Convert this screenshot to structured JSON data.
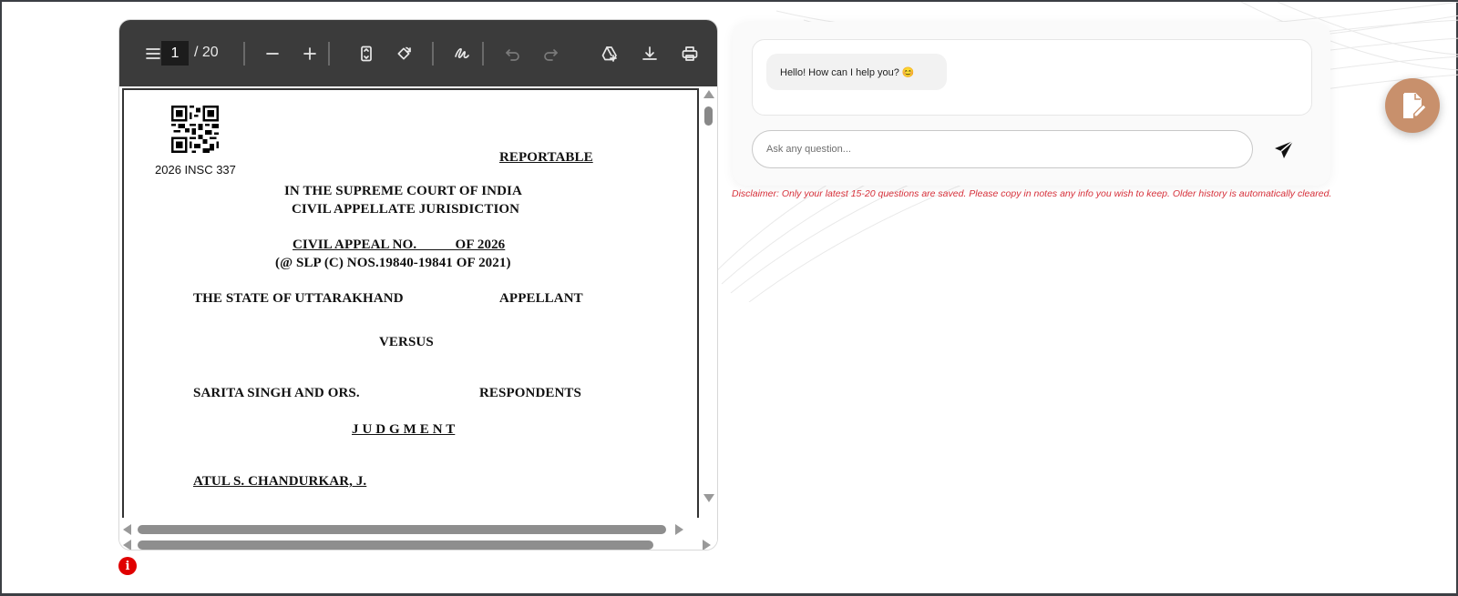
{
  "viewer": {
    "current_page": "1",
    "total_pages": "/ 20",
    "icons": {
      "menu": "menu-icon",
      "zoom_out": "minus-icon",
      "zoom_in": "plus-icon",
      "fit_page": "fit-page-icon",
      "rotate": "rotate-icon",
      "draw": "draw-icon",
      "undo": "undo-icon",
      "redo": "redo-icon",
      "drive": "save-to-drive-icon",
      "download": "download-icon",
      "print": "print-icon"
    }
  },
  "document": {
    "citation": "2026 INSC 337",
    "reportable": "REPORTABLE",
    "court": "IN THE SUPREME COURT OF INDIA",
    "jurisdiction": "CIVIL APPELLATE JURISDICTION",
    "appeal_no": "CIVIL APPEAL NO.           OF 2026",
    "slp": "(@ SLP (C) NOS.19840-19841 OF 2021)",
    "appellant_name": "THE STATE OF UTTARAKHAND",
    "appellant_label": "APPELLANT",
    "versus": "VERSUS",
    "respondent_name": "SARITA SINGH AND ORS.",
    "respondent_label": "RESPONDENTS",
    "judgment": "J U D G M E N T",
    "judge": "ATUL S. CHANDURKAR, J."
  },
  "chat": {
    "greeting": "Hello! How can I help you? 😊",
    "input_placeholder": "Ask any question...",
    "input_value": "",
    "disclaimer": "Disclaimer: Only your latest 15-20 questions are saved. Please copy in notes any info you wish to keep. Older history is automatically cleared.",
    "send_icon": "send-icon",
    "notes_icon": "edit-note-icon"
  },
  "colors": {
    "toolbar": "#3b3b3b",
    "fab": "#c8906c",
    "disclaimer": "#d6303a",
    "info": "#e00000"
  }
}
